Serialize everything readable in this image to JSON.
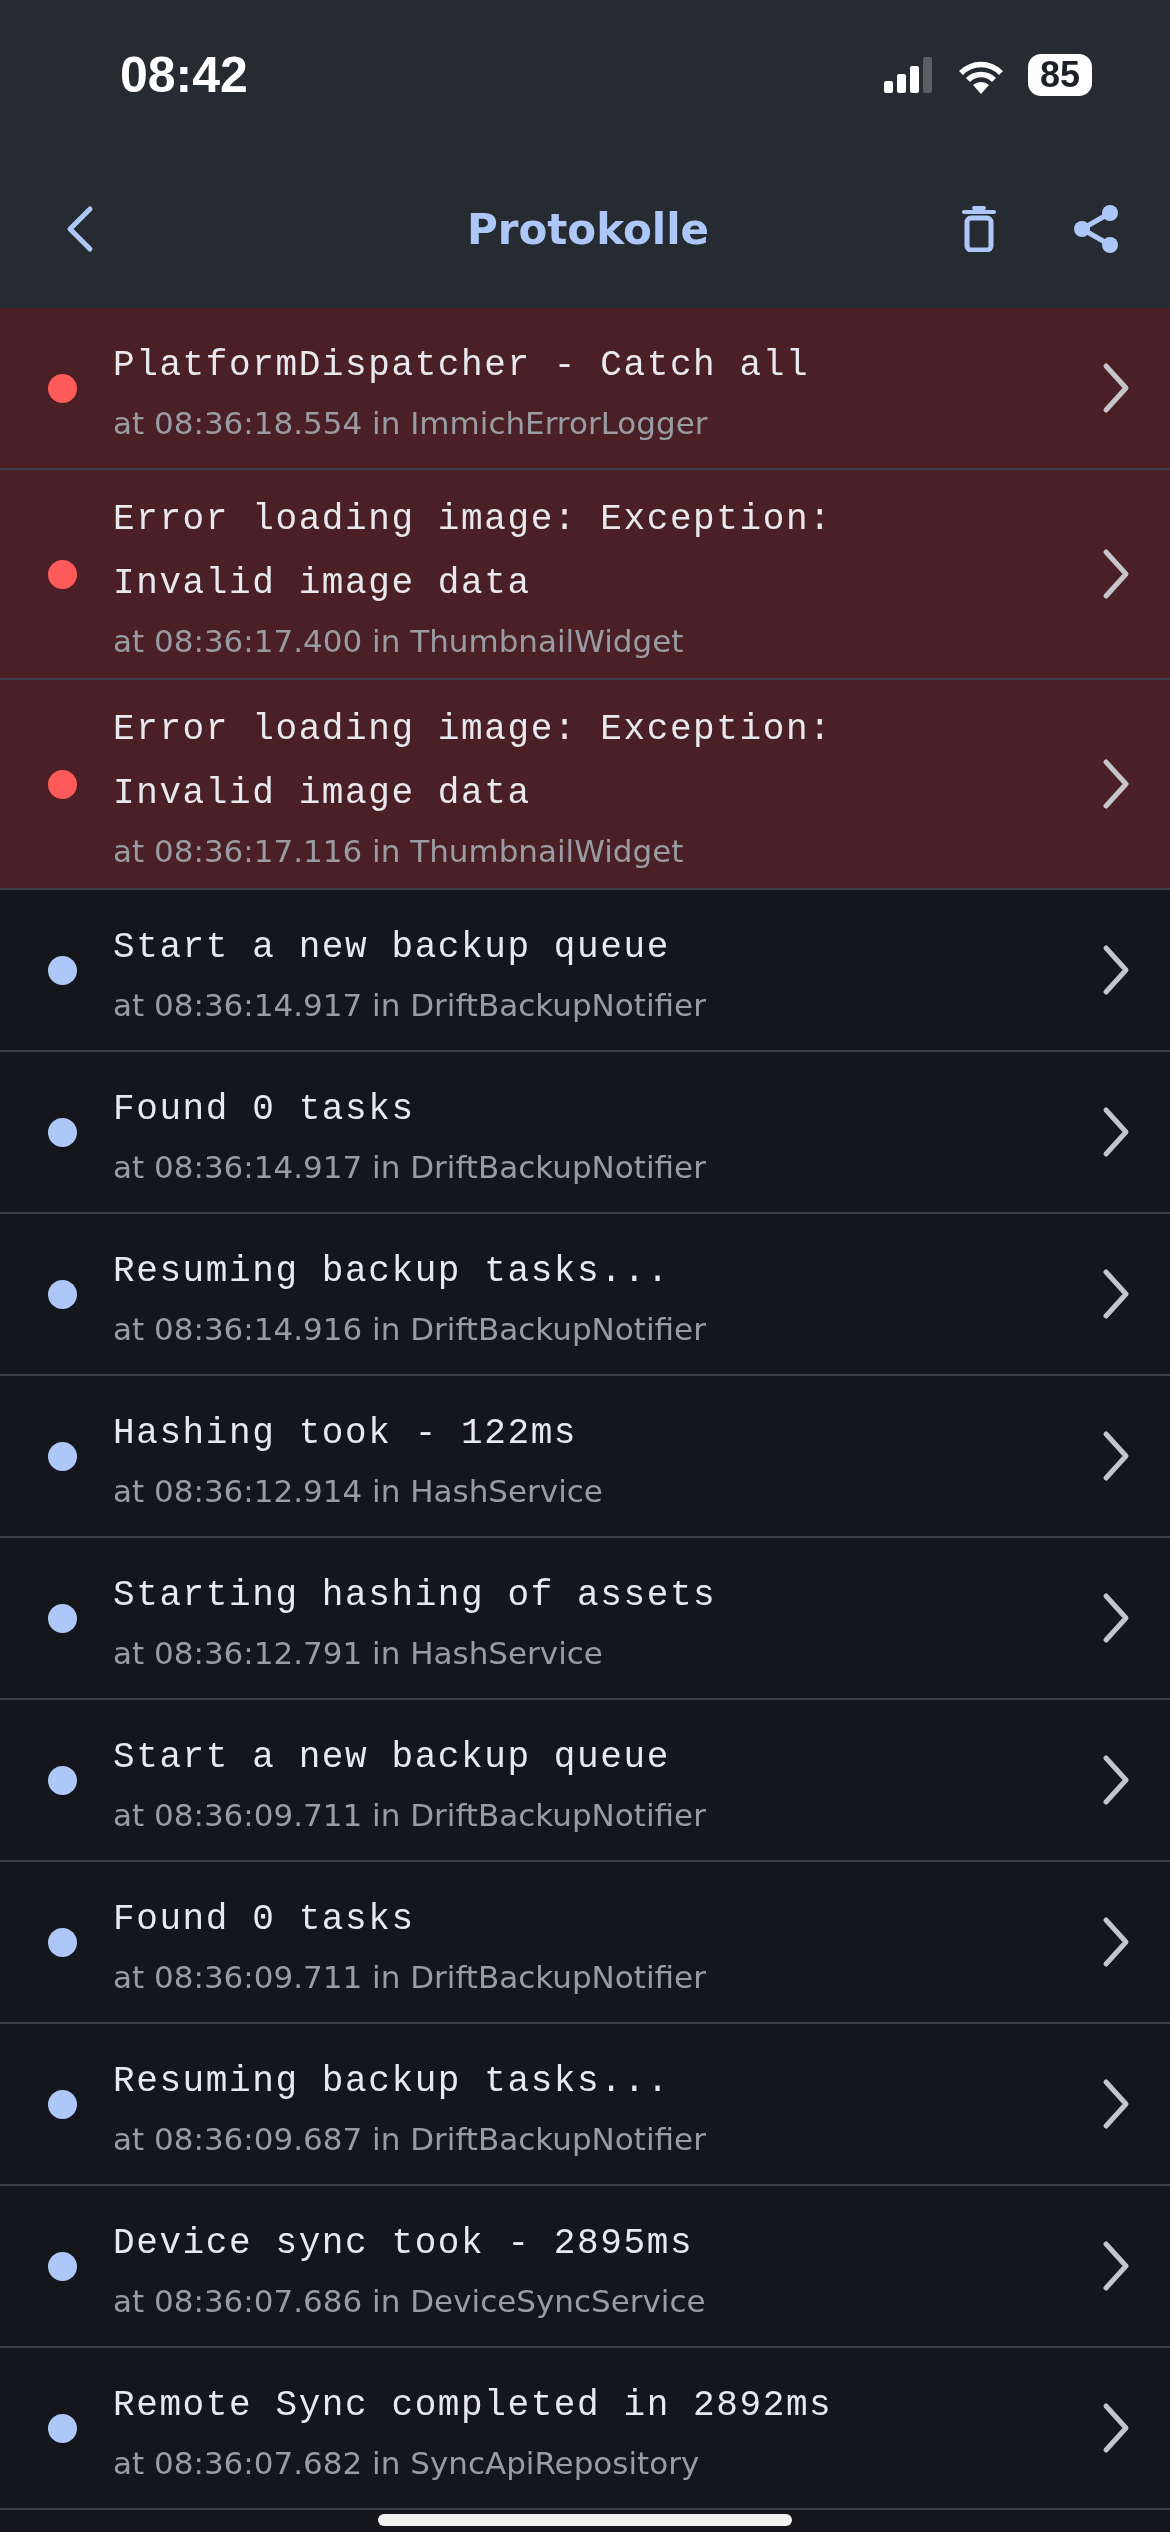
{
  "status_bar": {
    "time": "08:42",
    "battery": "85"
  },
  "nav": {
    "title": "Protokolle"
  },
  "logs": [
    {
      "kind": "error",
      "message": "PlatformDispatcher - Catch all",
      "detail": "at 08:36:18.554 in ImmichErrorLogger"
    },
    {
      "kind": "error",
      "message": "Error loading image: Exception: Invalid image data",
      "detail": "at 08:36:17.400 in ThumbnailWidget"
    },
    {
      "kind": "error",
      "message": "Error loading image: Exception: Invalid image data",
      "detail": "at 08:36:17.116 in ThumbnailWidget"
    },
    {
      "kind": "info",
      "message": "Start a new backup queue",
      "detail": "at 08:36:14.917 in DriftBackupNotifier"
    },
    {
      "kind": "info",
      "message": "Found 0 tasks",
      "detail": "at 08:36:14.917 in DriftBackupNotifier"
    },
    {
      "kind": "info",
      "message": "Resuming backup tasks...",
      "detail": "at 08:36:14.916 in DriftBackupNotifier"
    },
    {
      "kind": "info",
      "message": "Hashing took - 122ms",
      "detail": "at 08:36:12.914 in HashService"
    },
    {
      "kind": "info",
      "message": "Starting hashing of assets",
      "detail": "at 08:36:12.791 in HashService"
    },
    {
      "kind": "info",
      "message": "Start a new backup queue",
      "detail": "at 08:36:09.711 in DriftBackupNotifier"
    },
    {
      "kind": "info",
      "message": "Found 0 tasks",
      "detail": "at 08:36:09.711 in DriftBackupNotifier"
    },
    {
      "kind": "info",
      "message": "Resuming backup tasks...",
      "detail": "at 08:36:09.687 in DriftBackupNotifier"
    },
    {
      "kind": "info",
      "message": "Device sync took - 2895ms",
      "detail": "at 08:36:07.686 in DeviceSyncService"
    },
    {
      "kind": "info",
      "message": "Remote Sync completed in 2892ms",
      "detail": "at 08:36:07.682 in SyncApiRepository"
    }
  ]
}
